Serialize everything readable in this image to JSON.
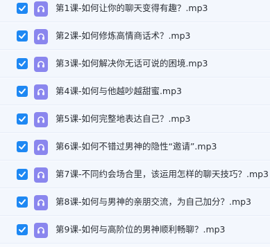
{
  "icons": {
    "checkbox": "checkbox-checked-icon",
    "file": "audio-headphones-icon"
  },
  "colors": {
    "checkbox": "#1e88f3",
    "file_icon": "#8a86ee",
    "row_bg": "#f3f7fd",
    "text": "#2b2f36"
  },
  "files": [
    {
      "name": "第1课-如何让你的聊天变得有趣？.mp3",
      "checked": true
    },
    {
      "name": "第2课-如何修炼高情商话术？.mp3",
      "checked": true
    },
    {
      "name": "第3课-如何解决你无话可说的困境.mp3",
      "checked": true
    },
    {
      "name": "第4课-如何与他越吵越甜蜜.mp3",
      "checked": true
    },
    {
      "name": "第5课-如何完整地表达自己？.mp3",
      "checked": true
    },
    {
      "name": "第6课-如何不错过男神的隐性“邀请”.mp3",
      "checked": true
    },
    {
      "name": "第7课-不同约会场合里，该运用怎样的聊天技巧？.mp3",
      "checked": true
    },
    {
      "name": "第8课-如何与男神的亲朋交流，为自己加分？.mp3",
      "checked": true
    },
    {
      "name": "第9课-如何与高阶位的男神顺利畅聊？.mp3",
      "checked": true
    }
  ]
}
